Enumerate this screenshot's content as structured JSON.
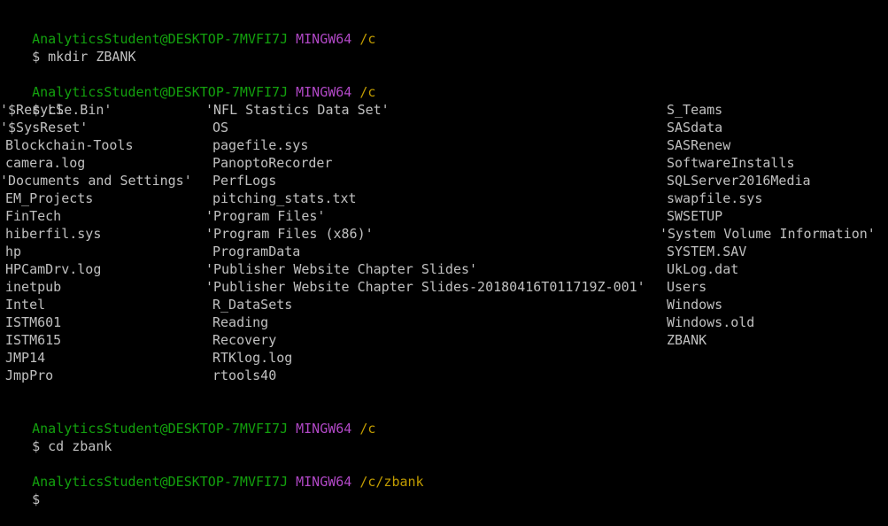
{
  "colors": {
    "background": "#000000",
    "text": "#c0c0c0",
    "user_host": "#13a10e",
    "msystem": "#b148c6",
    "path": "#c19c00"
  },
  "prompt": {
    "user_host": "AnalyticsStudent@DESKTOP-7MVFI7J",
    "msystem": "MINGW64",
    "symbol": "$"
  },
  "blocks": [
    {
      "path": "/c",
      "command": "mkdir ZBANK"
    },
    {
      "path": "/c",
      "command": "LS"
    },
    {
      "path": "/c",
      "command": "cd zbank"
    },
    {
      "path": "/c/zbank",
      "command": ""
    }
  ],
  "ls_output": {
    "col1": [
      "'$Recycle.Bin'",
      "'$SysReset'",
      "Blockchain-Tools",
      "camera.log",
      "'Documents and Settings'",
      "EM_Projects",
      "FinTech",
      "hiberfil.sys",
      "hp",
      "HPCamDrv.log",
      "inetpub",
      "Intel",
      "ISTM601",
      "ISTM615",
      "JMP14",
      "JmpPro"
    ],
    "col2": [
      "'NFL Stastics Data Set'",
      "OS",
      "pagefile.sys",
      "PanoptoRecorder",
      "PerfLogs",
      "pitching_stats.txt",
      "'Program Files'",
      "'Program Files (x86)'",
      "ProgramData",
      "'Publisher Website Chapter Slides'",
      "'Publisher Website Chapter Slides-20180416T011719Z-001'",
      "R_DataSets",
      "Reading",
      "Recovery",
      "RTKlog.log",
      "rtools40"
    ],
    "col3": [
      "S_Teams",
      "SASdata",
      "SASRenew",
      "SoftwareInstalls",
      "SQLServer2016Media",
      "swapfile.sys",
      "SWSETUP",
      "'System Volume Information'",
      "SYSTEM.SAV",
      "UkLog.dat",
      "Users",
      "Windows",
      "Windows.old",
      "ZBANK"
    ]
  }
}
